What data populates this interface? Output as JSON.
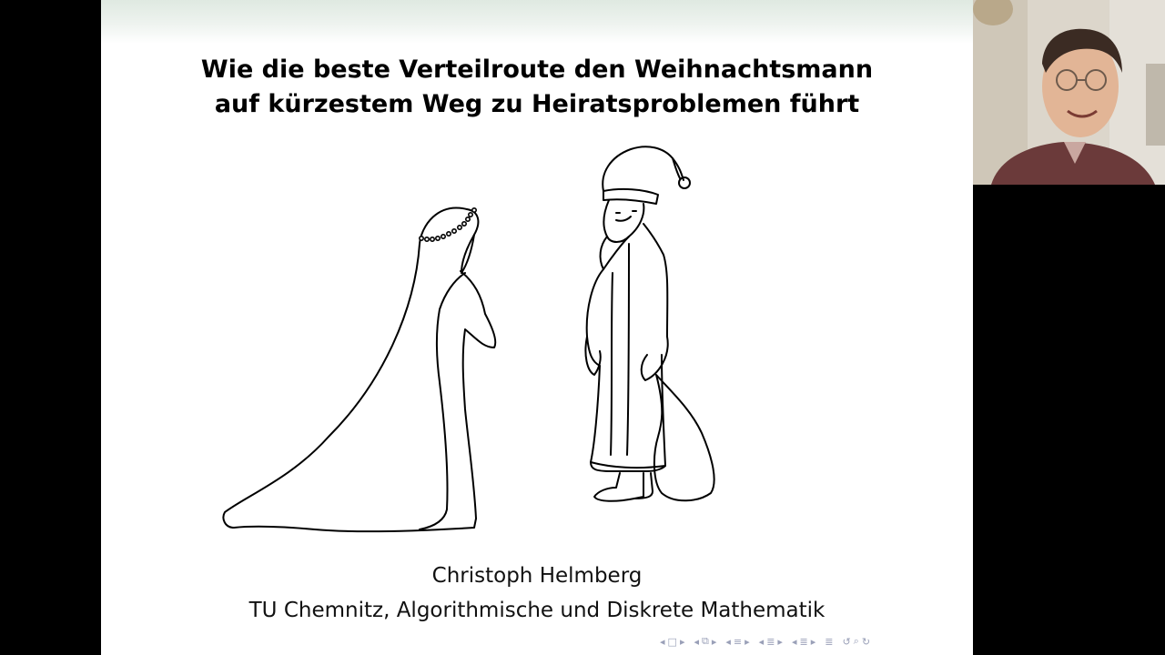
{
  "slide": {
    "title_line1": "Wie die beste Verteilroute den Weihnachtsmann",
    "title_line2": "auf kürzestem Weg zu Heiratsproblemen führt",
    "author": "Christoph Helmberg",
    "affiliation": "TU Chemnitz, Algorithmische und Diskrete Mathematik",
    "illustration": [
      "bride-with-veil-drawing",
      "santa-claus-with-sack-drawing"
    ]
  },
  "navigation": {
    "icons": [
      "nav-prev-arrow-icon",
      "slide-frame-icon",
      "nav-next-arrow-icon",
      "subsection-icon",
      "section-icon",
      "document-icon",
      "outline-icon",
      "undo-icon",
      "search-icon",
      "redo-icon"
    ]
  },
  "webcam": {
    "description_icon": "presenter-video-feed"
  },
  "colors": {
    "background": "#000000",
    "slide": "#ffffff",
    "header_gradient": "#dfe9e1",
    "nav_icons": "#9aa0b8"
  }
}
